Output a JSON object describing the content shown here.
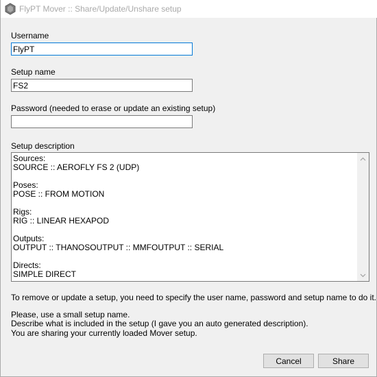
{
  "window": {
    "title": "FlyPT Mover :: Share/Update/Unshare setup",
    "icon": "app-icon"
  },
  "form": {
    "username_label": "Username",
    "username_value": "FlyPT",
    "setup_name_label": "Setup name",
    "setup_name_value": "FS2",
    "password_label": "Password (needed to erase or update an existing setup)",
    "password_value": "",
    "description_label": "Setup description",
    "description_value": "Sources:\nSOURCE :: AEROFLY FS 2 (UDP)\n\nPoses:\nPOSE :: FROM MOTION\n\nRigs:\nRIG :: LINEAR HEXAPOD\n\nOutputs:\nOUTPUT :: THANOSOUTPUT :: MMFOUTPUT :: SERIAL\n\nDirects:\nSIMPLE DIRECT"
  },
  "info": {
    "line1": "To remove or update a setup, you need to specify the user name, password and setup name to do it.",
    "line2": "Please, use a small setup name.",
    "line3": "Describe what is included in the setup (I gave you an auto generated description).",
    "line4": "You are sharing your currently loaded Mover setup."
  },
  "buttons": {
    "cancel_label": "Cancel",
    "share_label": "Share"
  },
  "colors": {
    "focus_border": "#0078d7",
    "button_face": "#e1e1e1",
    "window_bg": "#f0f0f0",
    "title_text": "#aaaaaa"
  }
}
